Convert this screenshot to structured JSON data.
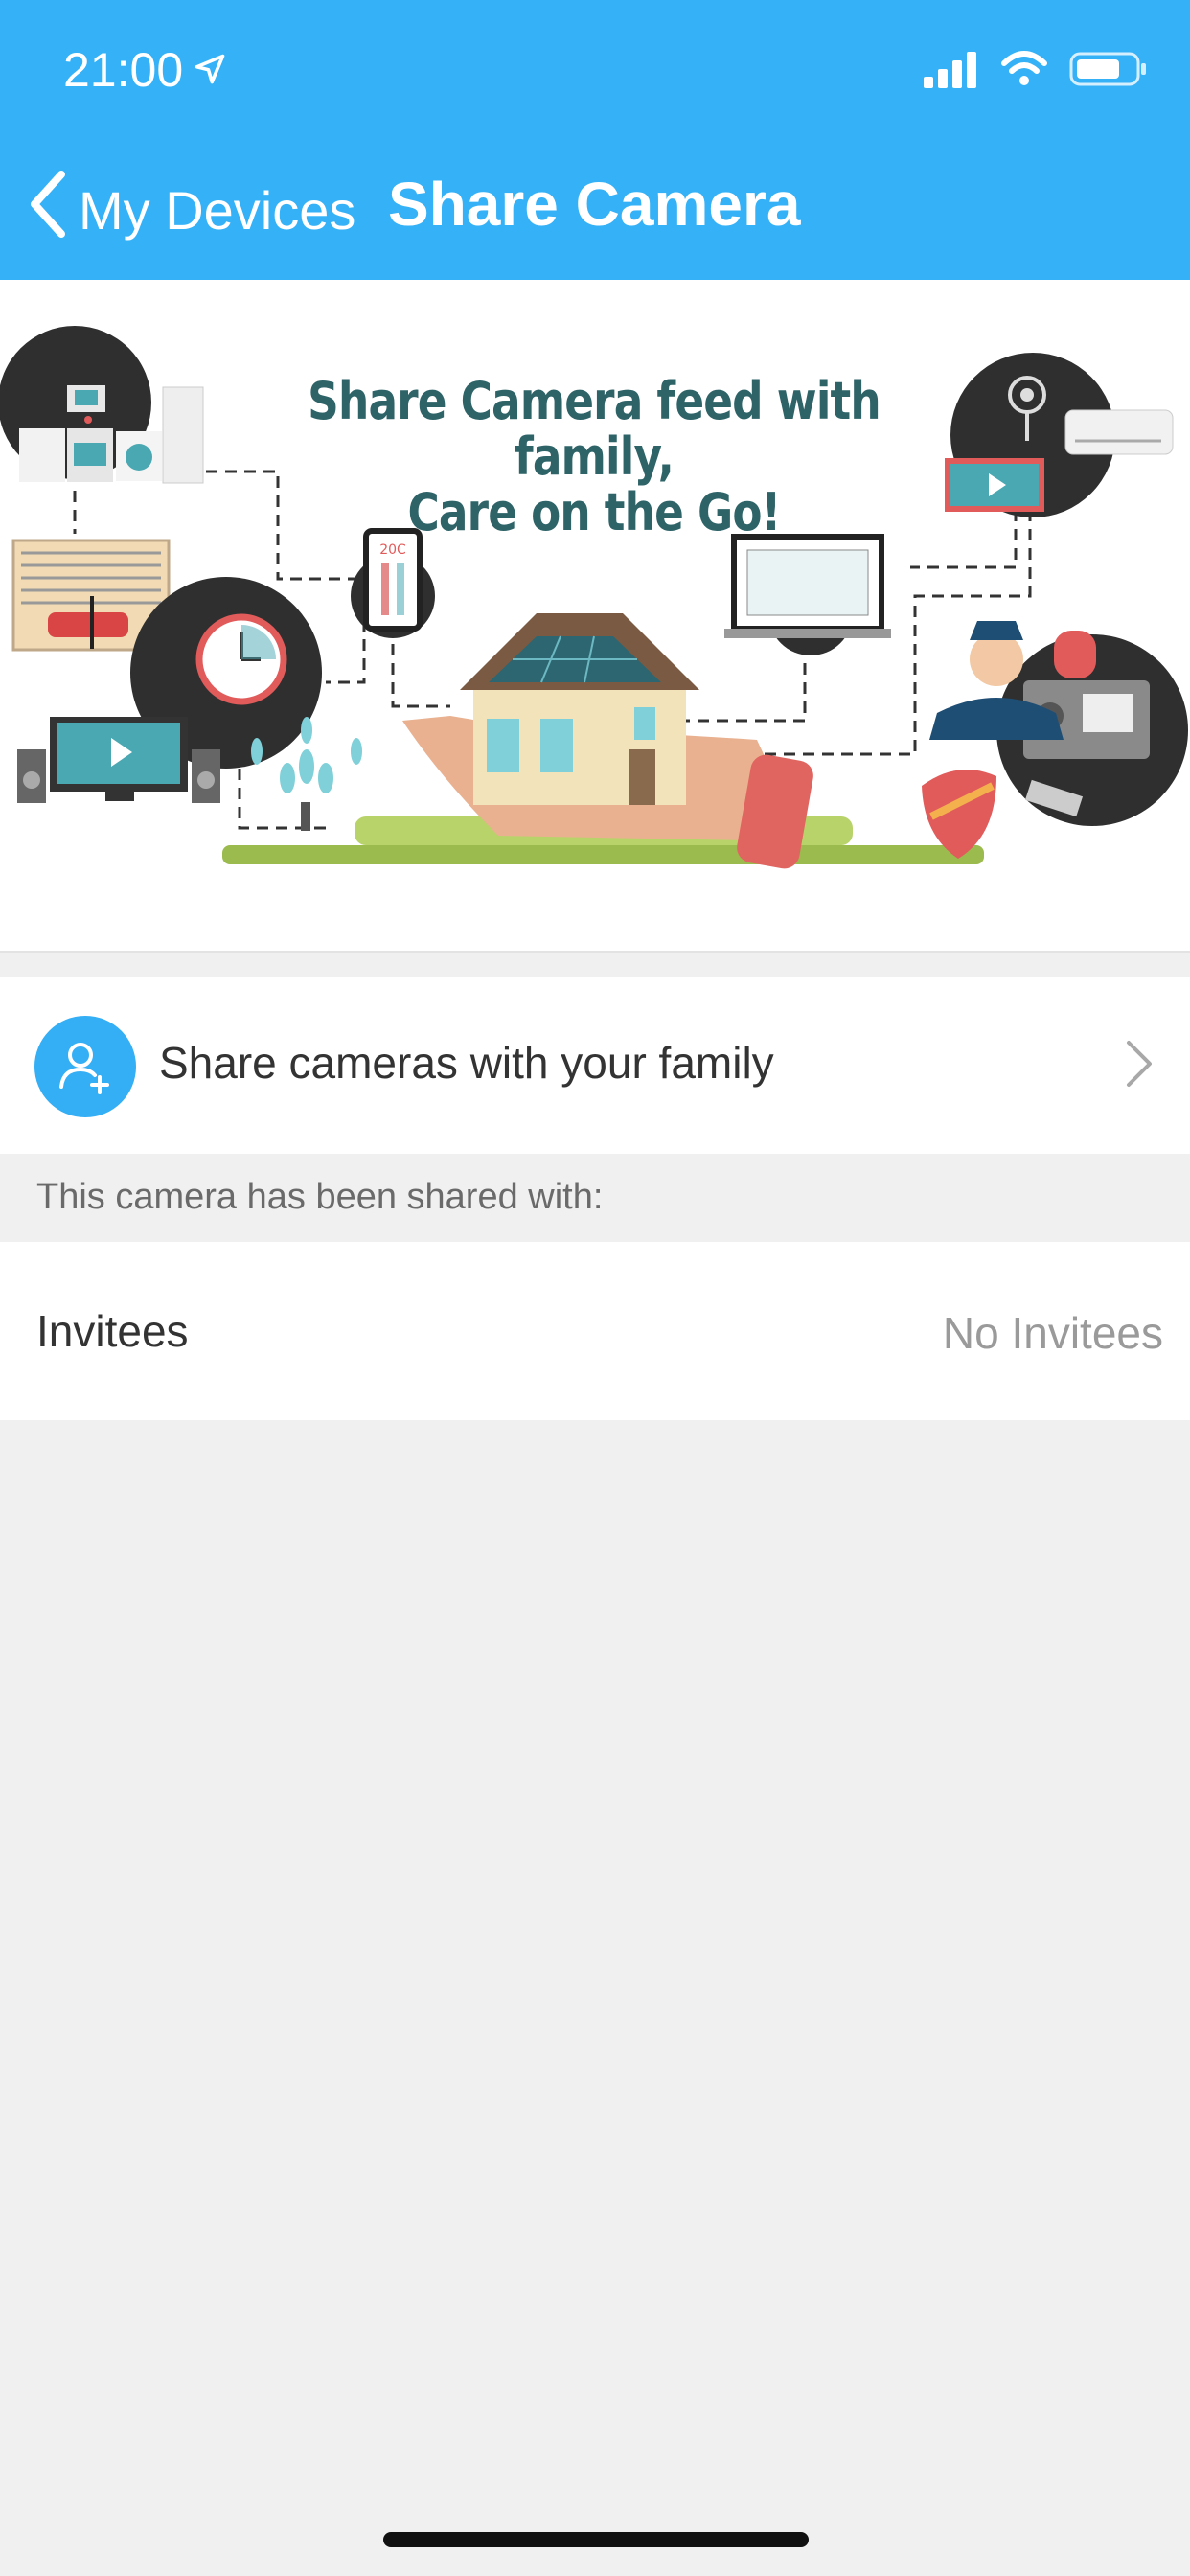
{
  "status_bar": {
    "time": "21:00",
    "icons": [
      "location-arrow-icon",
      "signal-icon",
      "wifi-icon",
      "battery-icon"
    ]
  },
  "nav": {
    "back_label": "My Devices",
    "title": "Share Camera"
  },
  "banner": {
    "headline_line1": "Share Camera feed with family,",
    "headline_line2": "Care on the Go!",
    "thermostat_text": "20C"
  },
  "share_row": {
    "label": "Share cameras with your family",
    "icon": "add-user-icon"
  },
  "section_caption": "This camera has been shared with:",
  "invitees": {
    "label": "Invitees",
    "value": "No Invitees"
  },
  "colors": {
    "header_bg": "#34b1f7",
    "accent": "#34aef5",
    "page_bg": "#f0f0f0"
  }
}
